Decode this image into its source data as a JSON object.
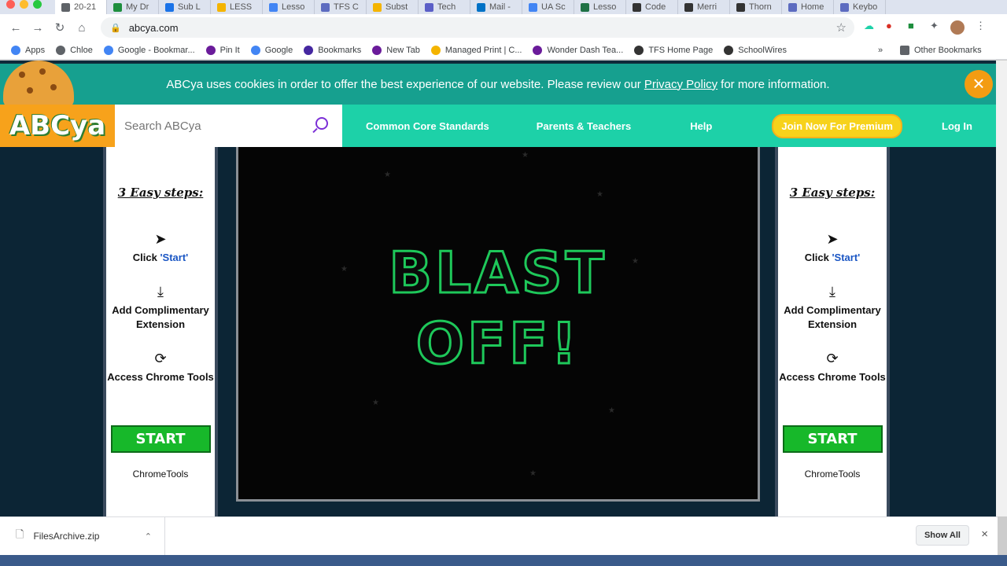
{
  "browser": {
    "tabs": [
      {
        "label": "20-21",
        "color": "#5f6368"
      },
      {
        "label": "My Dr",
        "color": "#1e8e3e"
      },
      {
        "label": "Sub L",
        "color": "#1a73e8"
      },
      {
        "label": "LESS",
        "color": "#f4b400"
      },
      {
        "label": "Lesso",
        "color": "#4285f4"
      },
      {
        "label": "TFS C",
        "color": "#5c6bc0"
      },
      {
        "label": "Subst",
        "color": "#f4b400"
      },
      {
        "label": "Tech",
        "color": "#5b5fc7"
      },
      {
        "label": "Mail -",
        "color": "#0072c6"
      },
      {
        "label": "UA Sc",
        "color": "#4285f4"
      },
      {
        "label": "Lesso",
        "color": "#1e7145"
      },
      {
        "label": "Code",
        "color": "#333333"
      },
      {
        "label": "Merri",
        "color": "#333333"
      },
      {
        "label": "Thorn",
        "color": "#333333"
      },
      {
        "label": "Home",
        "color": "#5c6bc0"
      },
      {
        "label": "Keybo",
        "color": "#5c6bc0"
      }
    ],
    "url": "abcya.com",
    "bookmarks": [
      {
        "label": "Apps",
        "color": "#4285f4"
      },
      {
        "label": "Chloe",
        "color": "#5f6368"
      },
      {
        "label": "Google - Bookmar...",
        "color": "#4285f4"
      },
      {
        "label": "Pin It",
        "color": "#6a1b9a"
      },
      {
        "label": "Google",
        "color": "#4285f4"
      },
      {
        "label": "Bookmarks",
        "color": "#4527a0"
      },
      {
        "label": "New Tab",
        "color": "#6a1b9a"
      },
      {
        "label": "Managed Print | C...",
        "color": "#f4b400"
      },
      {
        "label": "Wonder Dash Tea...",
        "color": "#6a1b9a"
      },
      {
        "label": "TFS Home Page",
        "color": "#333333"
      },
      {
        "label": "SchoolWires",
        "color": "#333333"
      }
    ],
    "more_bookmarks": "»",
    "other_bookmarks": "Other Bookmarks"
  },
  "cookie_bar": {
    "text_before": "ABCya uses cookies in order to offer the best experience of our website. Please review our",
    "link": "Privacy Policy",
    "text_after": "for more information.",
    "close": "×"
  },
  "header": {
    "logo": "ABCya",
    "search_placeholder": "Search ABCya",
    "nav": [
      "Common Core Standards",
      "Parents & Teachers",
      "Help"
    ],
    "premium": "Join Now For Premium",
    "login": "Log In"
  },
  "sidebar": {
    "title": "3 Easy steps:",
    "step1_prefix": "Click",
    "step1_link": "'Start'",
    "step2": "Add Complimentary Extension",
    "step3": "Access Chrome Tools",
    "start": "START",
    "brand": "ChromeTools"
  },
  "game": {
    "line1": "BLAST",
    "line2": "OFF!"
  },
  "downloads": {
    "file": "FilesArchive.zip",
    "show_all": "Show All",
    "close": "×"
  }
}
